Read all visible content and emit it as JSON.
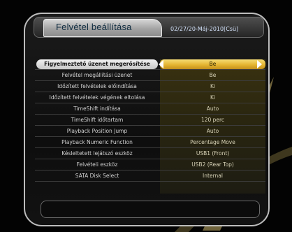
{
  "header": {
    "title": "Felvétel beállítása",
    "datetime": "02/27/20-Máj-2010[Csü]"
  },
  "menu": {
    "items": [
      {
        "label": "Figyelmeztető üzenet megerősítése",
        "value": "Be"
      },
      {
        "label": "Felvétel megállítási üzenet",
        "value": "Be"
      },
      {
        "label": "Időzített felvételek előindítása",
        "value": "Ki"
      },
      {
        "label": "Időzített felvételek végének eltolása",
        "value": "Ki"
      },
      {
        "label": "TimeShift indítása",
        "value": "Auto"
      },
      {
        "label": "TimeShift időtartam",
        "value": "120 perc"
      },
      {
        "label": "Playback Position Jump",
        "value": "Auto"
      },
      {
        "label": "Playback Numeric Function",
        "value": "Percentage Move"
      },
      {
        "label": "Késleltetett lejátszó eszköz",
        "value": "USB1 (Front)"
      },
      {
        "label": "Felvételi eszköz",
        "value": "USB2 (Rear Top)"
      },
      {
        "label": "SATA Disk Select",
        "value": "Internal"
      }
    ],
    "selected_index": 0
  },
  "colors": {
    "selected_value_bg": "#e4b531",
    "value_panel": "#2b2710",
    "frame_border": "#bdbdbd"
  },
  "icons": {
    "left": "arrow-left-icon",
    "right": "arrow-right-icon"
  }
}
